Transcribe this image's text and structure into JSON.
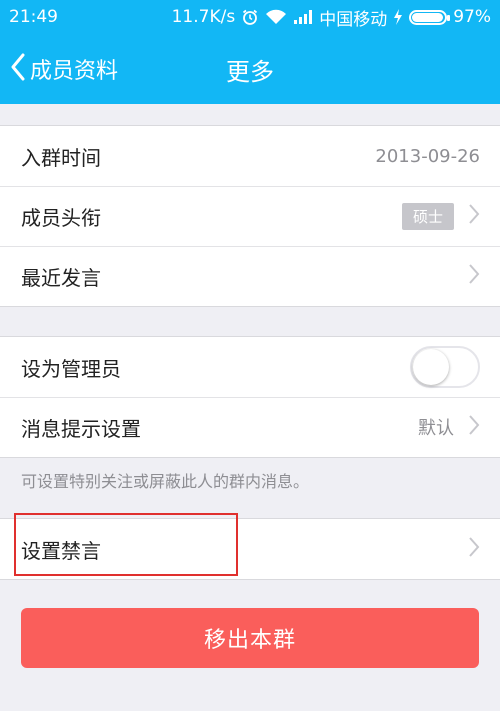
{
  "status_bar": {
    "time": "21:49",
    "net_speed": "11.7K/s",
    "carrier": "中国移动",
    "battery": "97%",
    "battery_level": 0.97
  },
  "nav": {
    "back_label": "成员资料",
    "title": "更多"
  },
  "group1": {
    "join_time_label": "入群时间",
    "join_time_value": "2013-09-26",
    "member_title_label": "成员头衔",
    "member_title_value": "硕士",
    "recent_posts_label": "最近发言"
  },
  "group2": {
    "set_admin_label": "设为管理员",
    "set_admin_on": false,
    "msg_setting_label": "消息提示设置",
    "msg_setting_value": "默认"
  },
  "hint_text": "可设置特别关注或屏蔽此人的群内消息。",
  "group3": {
    "mute_label": "设置禁言"
  },
  "remove_button_label": "移出本群",
  "colors": {
    "header": "#12b7f5",
    "danger": "#fa5e5b",
    "highlight": "#e0302e"
  }
}
